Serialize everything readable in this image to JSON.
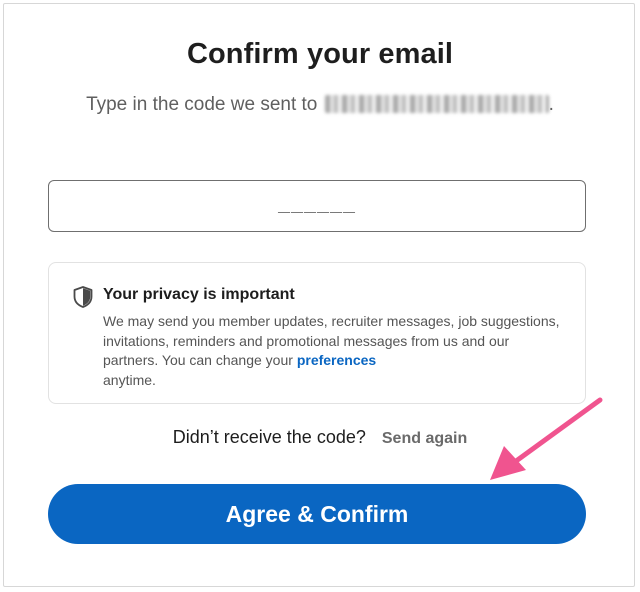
{
  "header": {
    "title": "Confirm your email",
    "subtitle_prefix": "Type in the code we sent to",
    "subtitle_suffix": "."
  },
  "code_field": {
    "placeholder": "______",
    "value": ""
  },
  "privacy": {
    "icon": "shield-icon",
    "title": "Your privacy is important",
    "body_text": "We may send you member updates, recruiter messages, job suggestions, invitations, reminders and promotional messages from us and our partners. You can change your",
    "link_label": "preferences",
    "body_suffix": "anytime."
  },
  "resend": {
    "question": "Didn’t receive the code?",
    "action_label": "Send again"
  },
  "primary_action": {
    "label": "Agree & Confirm"
  },
  "colors": {
    "accent": "#0a66c2",
    "annotation_arrow": "#f0548f",
    "text_primary": "#1d1d1d",
    "text_muted": "#5f5f5f"
  }
}
